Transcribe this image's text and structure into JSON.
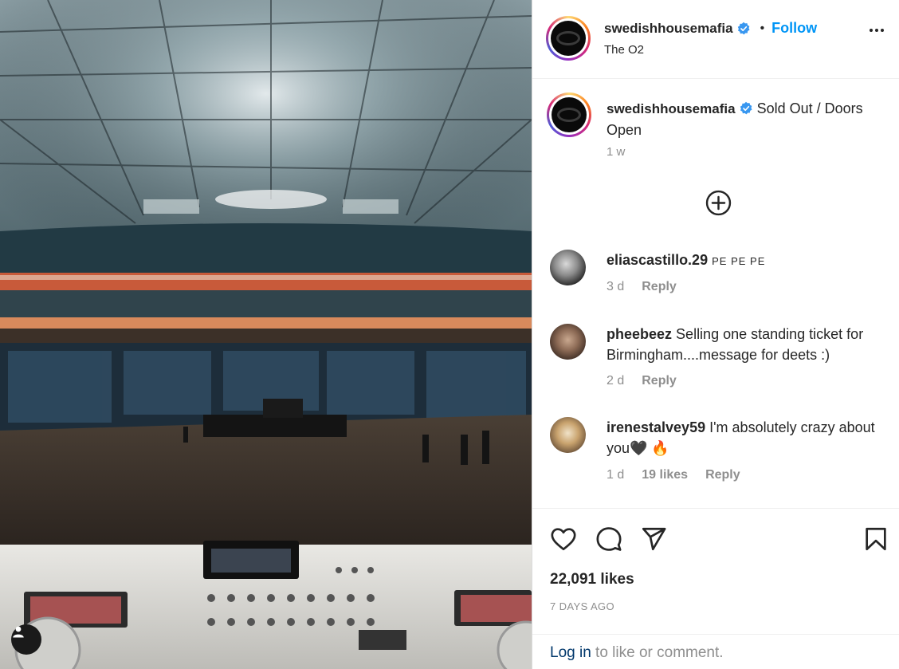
{
  "post": {
    "username": "swedishhousemafia",
    "follow_label": "Follow",
    "location": "The O2",
    "caption_text": "Sold Out / Doors Open",
    "caption_time": "1 w",
    "likes": "22,091 likes",
    "date": "7 DAYS AGO"
  },
  "comments": [
    {
      "username": "eliascastillo.29",
      "text": "PE PE PE",
      "time": "3 d",
      "likes": "",
      "reply": "Reply"
    },
    {
      "username": "pheebeez",
      "text": "Selling one standing ticket for Birmingham....message for deets :)",
      "time": "2 d",
      "likes": "",
      "reply": "Reply"
    },
    {
      "username": "irenestalvey59",
      "text": "I'm absolutely crazy about you🖤 🔥",
      "time": "1 d",
      "likes": "19 likes",
      "reply": "Reply"
    }
  ],
  "footer": {
    "login_label": "Log in",
    "login_suffix": " to like or comment."
  },
  "icons": {
    "verified": "verified-badge-icon",
    "more": "more-options-icon",
    "load_more": "plus-circle-icon",
    "like": "heart-icon",
    "comment": "comment-bubble-icon",
    "share": "paper-plane-icon",
    "save": "bookmark-icon",
    "tag": "user-tag-icon"
  },
  "colors": {
    "follow": "#0095f6",
    "verified": "#3897f0",
    "link": "#00376b",
    "secondary_text": "#8e8e8e"
  }
}
